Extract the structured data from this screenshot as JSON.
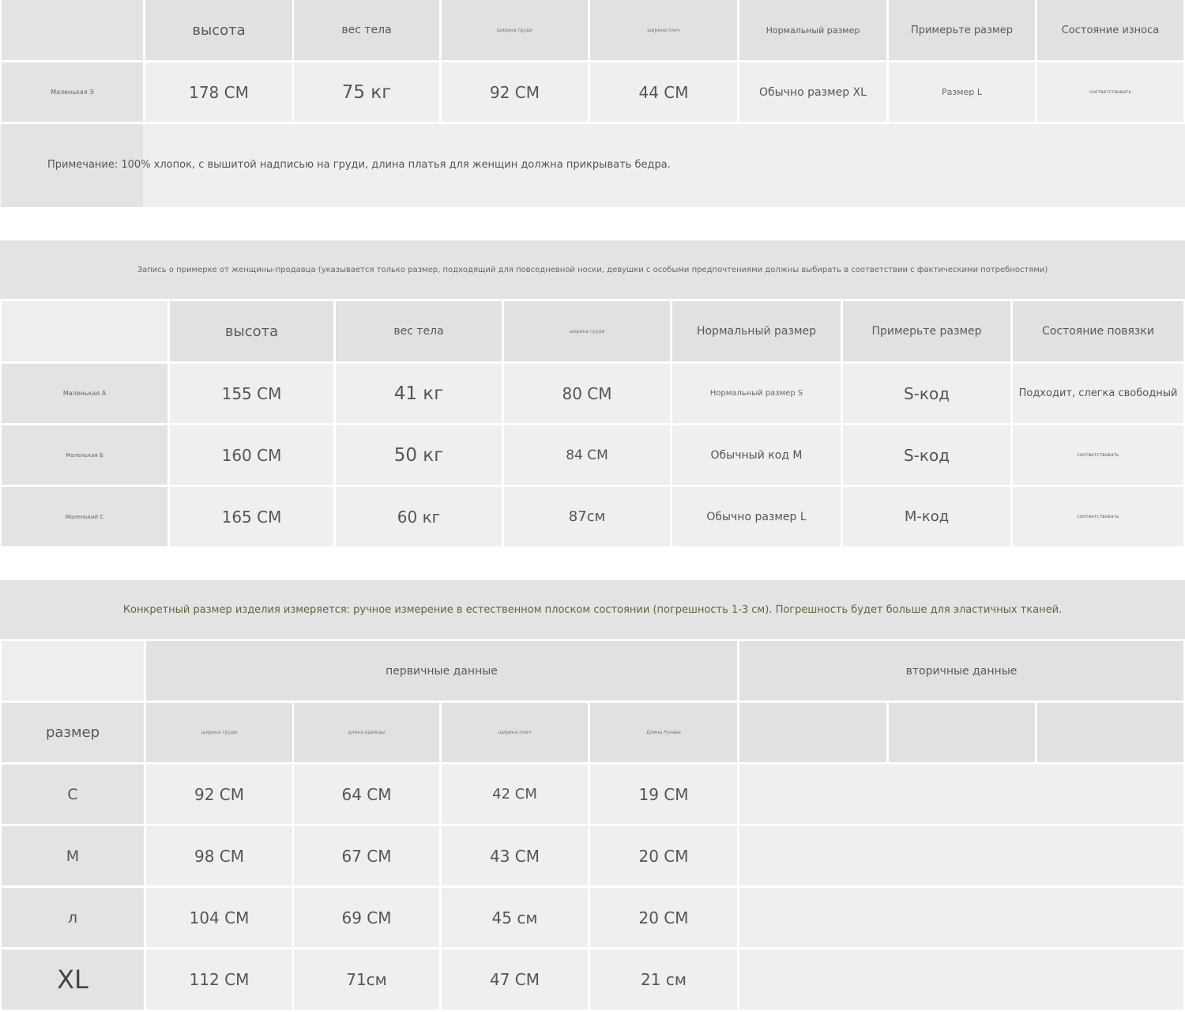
{
  "table1": {
    "headers": [
      "высота",
      "вес тела",
      "ширина груди",
      "ширина плеч",
      "Нормальный размер",
      "Примерьте размер",
      "Состояние износа"
    ],
    "row": {
      "label": "Маленькая Э",
      "values": [
        "178 СМ",
        "75 кг",
        "92 СМ",
        "44 СМ",
        "Обычно размер XL",
        "Размер L",
        "соответствовать"
      ]
    },
    "note": "Примечание: 100% хлопок, с вышитой надписью на груди, длина платья для женщин должна прикрывать бедра."
  },
  "table2": {
    "caption": "Запись о примерке от женщины-продавца (указывается только размер, подходящий для повседневной носки, девушки с особыми предпочтениями должны выбирать в соответствии с фактическими потребностями)",
    "headers": [
      "высота",
      "вес тела",
      "ширина груди",
      "Нормальный размер",
      "Примерьте размер",
      "Состояние повязки"
    ],
    "rows": [
      {
        "label": "Маленькая А",
        "values": [
          "155 СМ",
          "41 кг",
          "80 СМ",
          "Нормальный размер S",
          "S-код",
          "Подходит, слегка свободный"
        ]
      },
      {
        "label": "Маленькая Б",
        "values": [
          "160 СМ",
          "50 кг",
          "84 СМ",
          "Обычный код М",
          "S-код",
          "соответствовать"
        ]
      },
      {
        "label": "Маленький С",
        "values": [
          "165 СМ",
          "60 кг",
          "87см",
          "Обычно размер L",
          "М-код",
          "соответствовать"
        ]
      }
    ]
  },
  "table3": {
    "caption": "Конкретный размер изделия измеряется: ручное измерение в естественном плоском состоянии (погрешность 1-3 см). Погрешность будет больше для эластичных тканей.",
    "group_primary": "первичные данные",
    "group_secondary": "вторичные данные",
    "size_header": "размер",
    "headers": [
      "ширина груди",
      "длина одежды",
      "ширина плеч",
      "Длина Рукава"
    ],
    "rows": [
      {
        "size": "С",
        "values": [
          "92 СМ",
          "64 СМ",
          "42 СМ",
          "19 СМ"
        ]
      },
      {
        "size": "М",
        "values": [
          "98 СМ",
          "67 СМ",
          "43 СМ",
          "20 СМ"
        ]
      },
      {
        "size": "л",
        "values": [
          "104 СМ",
          "69 СМ",
          "45 см",
          "20 СМ"
        ]
      },
      {
        "size": "XL",
        "values": [
          "112 СМ",
          "71см",
          "47 СМ",
          "21 см"
        ]
      }
    ]
  }
}
